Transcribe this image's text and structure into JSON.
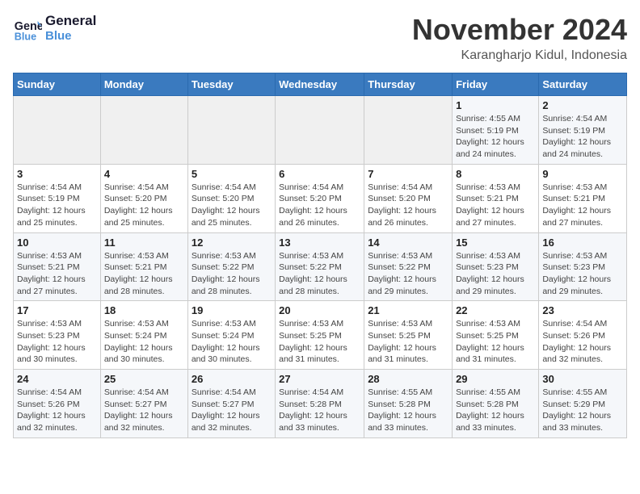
{
  "header": {
    "logo_line1": "General",
    "logo_line2": "Blue",
    "month_year": "November 2024",
    "location": "Karangharjo Kidul, Indonesia"
  },
  "columns": [
    "Sunday",
    "Monday",
    "Tuesday",
    "Wednesday",
    "Thursday",
    "Friday",
    "Saturday"
  ],
  "weeks": [
    [
      {
        "day": "",
        "info": ""
      },
      {
        "day": "",
        "info": ""
      },
      {
        "day": "",
        "info": ""
      },
      {
        "day": "",
        "info": ""
      },
      {
        "day": "",
        "info": ""
      },
      {
        "day": "1",
        "info": "Sunrise: 4:55 AM\nSunset: 5:19 PM\nDaylight: 12 hours and 24 minutes."
      },
      {
        "day": "2",
        "info": "Sunrise: 4:54 AM\nSunset: 5:19 PM\nDaylight: 12 hours and 24 minutes."
      }
    ],
    [
      {
        "day": "3",
        "info": "Sunrise: 4:54 AM\nSunset: 5:19 PM\nDaylight: 12 hours and 25 minutes."
      },
      {
        "day": "4",
        "info": "Sunrise: 4:54 AM\nSunset: 5:20 PM\nDaylight: 12 hours and 25 minutes."
      },
      {
        "day": "5",
        "info": "Sunrise: 4:54 AM\nSunset: 5:20 PM\nDaylight: 12 hours and 25 minutes."
      },
      {
        "day": "6",
        "info": "Sunrise: 4:54 AM\nSunset: 5:20 PM\nDaylight: 12 hours and 26 minutes."
      },
      {
        "day": "7",
        "info": "Sunrise: 4:54 AM\nSunset: 5:20 PM\nDaylight: 12 hours and 26 minutes."
      },
      {
        "day": "8",
        "info": "Sunrise: 4:53 AM\nSunset: 5:21 PM\nDaylight: 12 hours and 27 minutes."
      },
      {
        "day": "9",
        "info": "Sunrise: 4:53 AM\nSunset: 5:21 PM\nDaylight: 12 hours and 27 minutes."
      }
    ],
    [
      {
        "day": "10",
        "info": "Sunrise: 4:53 AM\nSunset: 5:21 PM\nDaylight: 12 hours and 27 minutes."
      },
      {
        "day": "11",
        "info": "Sunrise: 4:53 AM\nSunset: 5:21 PM\nDaylight: 12 hours and 28 minutes."
      },
      {
        "day": "12",
        "info": "Sunrise: 4:53 AM\nSunset: 5:22 PM\nDaylight: 12 hours and 28 minutes."
      },
      {
        "day": "13",
        "info": "Sunrise: 4:53 AM\nSunset: 5:22 PM\nDaylight: 12 hours and 28 minutes."
      },
      {
        "day": "14",
        "info": "Sunrise: 4:53 AM\nSunset: 5:22 PM\nDaylight: 12 hours and 29 minutes."
      },
      {
        "day": "15",
        "info": "Sunrise: 4:53 AM\nSunset: 5:23 PM\nDaylight: 12 hours and 29 minutes."
      },
      {
        "day": "16",
        "info": "Sunrise: 4:53 AM\nSunset: 5:23 PM\nDaylight: 12 hours and 29 minutes."
      }
    ],
    [
      {
        "day": "17",
        "info": "Sunrise: 4:53 AM\nSunset: 5:23 PM\nDaylight: 12 hours and 30 minutes."
      },
      {
        "day": "18",
        "info": "Sunrise: 4:53 AM\nSunset: 5:24 PM\nDaylight: 12 hours and 30 minutes."
      },
      {
        "day": "19",
        "info": "Sunrise: 4:53 AM\nSunset: 5:24 PM\nDaylight: 12 hours and 30 minutes."
      },
      {
        "day": "20",
        "info": "Sunrise: 4:53 AM\nSunset: 5:25 PM\nDaylight: 12 hours and 31 minutes."
      },
      {
        "day": "21",
        "info": "Sunrise: 4:53 AM\nSunset: 5:25 PM\nDaylight: 12 hours and 31 minutes."
      },
      {
        "day": "22",
        "info": "Sunrise: 4:53 AM\nSunset: 5:25 PM\nDaylight: 12 hours and 31 minutes."
      },
      {
        "day": "23",
        "info": "Sunrise: 4:54 AM\nSunset: 5:26 PM\nDaylight: 12 hours and 32 minutes."
      }
    ],
    [
      {
        "day": "24",
        "info": "Sunrise: 4:54 AM\nSunset: 5:26 PM\nDaylight: 12 hours and 32 minutes."
      },
      {
        "day": "25",
        "info": "Sunrise: 4:54 AM\nSunset: 5:27 PM\nDaylight: 12 hours and 32 minutes."
      },
      {
        "day": "26",
        "info": "Sunrise: 4:54 AM\nSunset: 5:27 PM\nDaylight: 12 hours and 32 minutes."
      },
      {
        "day": "27",
        "info": "Sunrise: 4:54 AM\nSunset: 5:28 PM\nDaylight: 12 hours and 33 minutes."
      },
      {
        "day": "28",
        "info": "Sunrise: 4:55 AM\nSunset: 5:28 PM\nDaylight: 12 hours and 33 minutes."
      },
      {
        "day": "29",
        "info": "Sunrise: 4:55 AM\nSunset: 5:28 PM\nDaylight: 12 hours and 33 minutes."
      },
      {
        "day": "30",
        "info": "Sunrise: 4:55 AM\nSunset: 5:29 PM\nDaylight: 12 hours and 33 minutes."
      }
    ]
  ]
}
